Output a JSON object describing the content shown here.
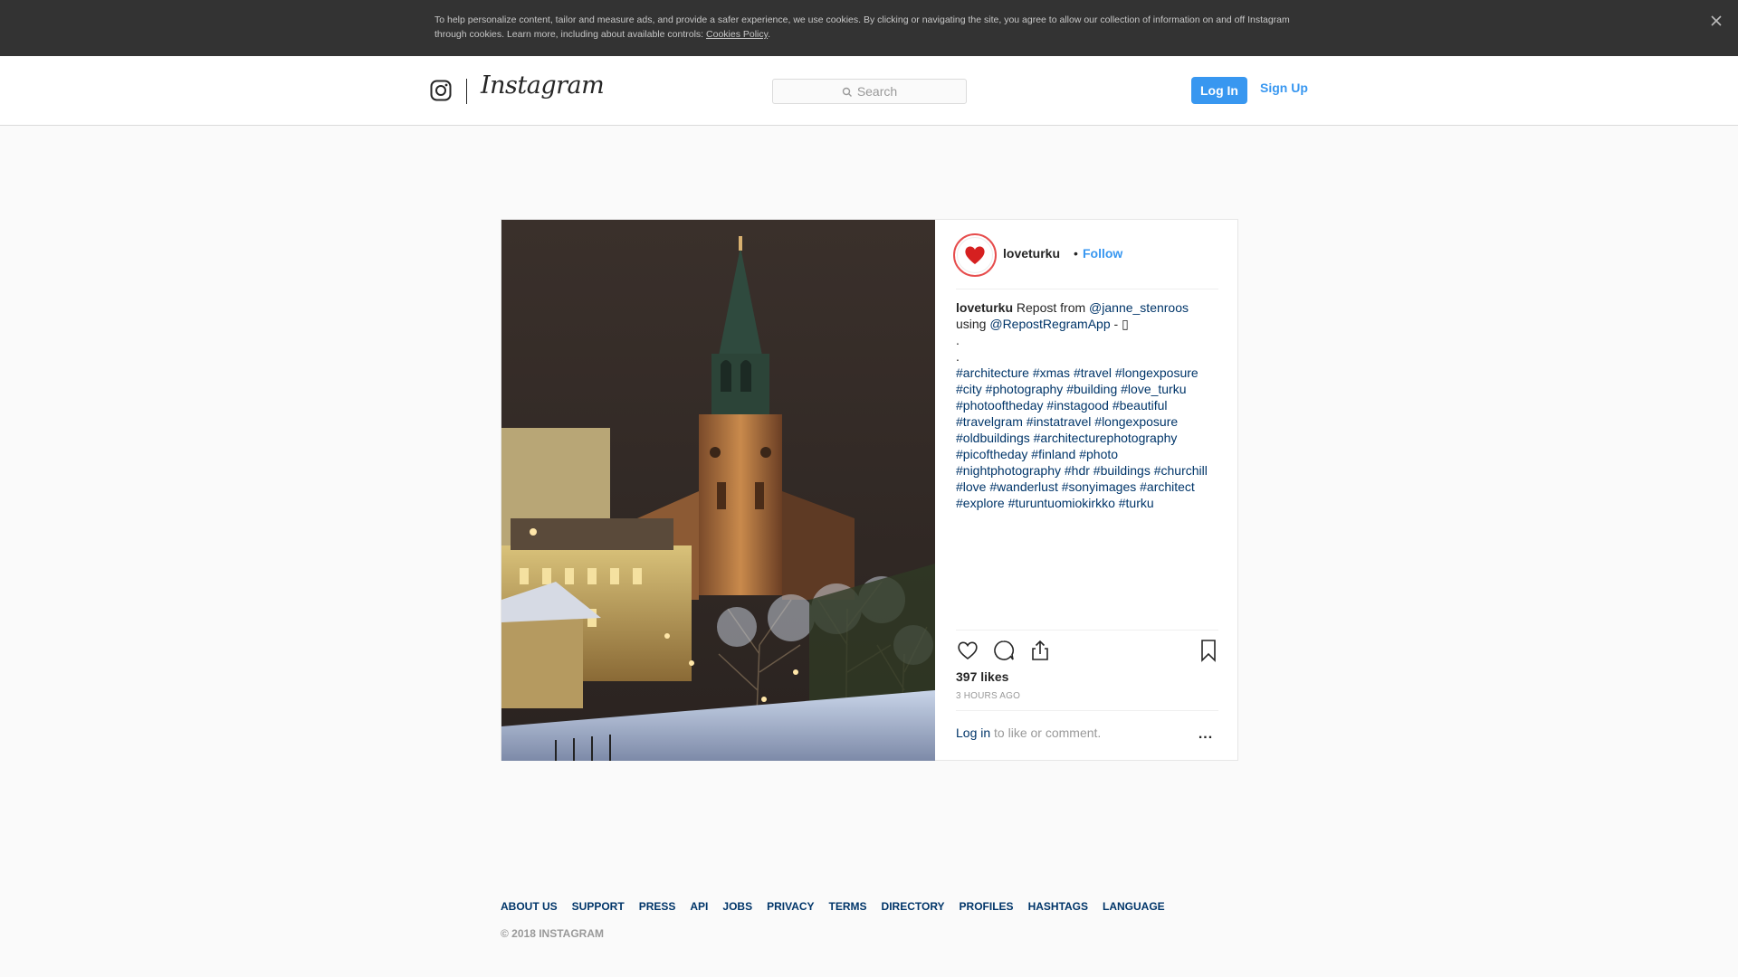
{
  "cookie_banner": {
    "text": "To help personalize content, tailor and measure ads, and provide a safer experience, we use cookies. By clicking or navigating the site, you agree to allow our collection of information on and off Instagram through cookies. Learn more, including about available controls: ",
    "link": "Cookies Policy",
    "trailing": ".",
    "close_icon": "close-icon"
  },
  "header": {
    "logo_icon": "instagram-glyph-icon",
    "wordmark": "Instagram",
    "search_placeholder": "Search",
    "login_label": "Log In",
    "signup_label": "Sign Up"
  },
  "post": {
    "username": "loveturku",
    "dot": "•",
    "follow_label": "Follow",
    "avatar_icon": "heart-icon",
    "caption": {
      "username": "loveturku",
      "text1": " Repost from ",
      "mention1": "@janne_stenroos",
      "text2": "using ",
      "mention2": "@RepostRegramApp",
      "text3": " - ",
      "text3_tail": "▯",
      "dot1": ".",
      "dot2": ".",
      "hashtag_lines": [
        "#architecture #xmas #travel #longexposure",
        "#city #photography #building #love_turku",
        "#photooftheday #instagood #beautiful",
        "#travelgram #instatravel #longexposure",
        "#oldbuildings #architecturephotography",
        "#picoftheday #finland #photo",
        "#nightphotography #hdr #buildings #churchill",
        "#love #wanderlust #sonyimages #architect",
        "#explore #turuntuomiokirkko #turku"
      ]
    },
    "likes": "397 likes",
    "time_ago": "3 HOURS AGO",
    "comment_login": "Log in",
    "comment_rest": " to like or comment.",
    "more": "..."
  },
  "footer": {
    "links": [
      "ABOUT US",
      "SUPPORT",
      "PRESS",
      "API",
      "JOBS",
      "PRIVACY",
      "TERMS",
      "DIRECTORY",
      "PROFILES",
      "HASHTAGS",
      "LANGUAGE"
    ],
    "copyright": "© 2018 INSTAGRAM"
  },
  "colors": {
    "accent": "#3897f0",
    "link_dark": "#003569",
    "cookie_bar": "#333333"
  }
}
